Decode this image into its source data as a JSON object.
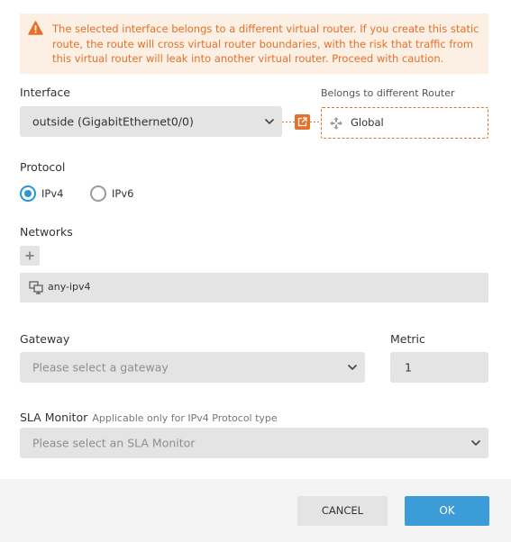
{
  "warning": {
    "text": "The selected interface belongs to a different virtual router. If you create this static route, the route will cross virtual router boundaries, with the risk that traffic from this virtual router will leak into another virtual router. Proceed with caution."
  },
  "interface": {
    "label": "Interface",
    "value": "outside (GigabitEthernet0/0)"
  },
  "router": {
    "label": "Belongs to different Router",
    "value": "Global"
  },
  "protocol": {
    "label": "Protocol",
    "options": [
      "IPv4",
      "IPv6"
    ],
    "selected": "IPv4"
  },
  "networks": {
    "label": "Networks",
    "items": [
      "any-ipv4"
    ]
  },
  "gateway": {
    "label": "Gateway",
    "placeholder": "Please select a gateway"
  },
  "metric": {
    "label": "Metric",
    "value": "1"
  },
  "sla": {
    "label": "SLA Monitor",
    "hint": "Applicable only for IPv4 Protocol type",
    "placeholder": "Please select an SLA Monitor"
  },
  "footer": {
    "cancel": "CANCEL",
    "ok": "OK"
  },
  "colors": {
    "accent": "#2b95d6",
    "warning": "#e3712a",
    "ok_button": "#3c9cd8"
  }
}
